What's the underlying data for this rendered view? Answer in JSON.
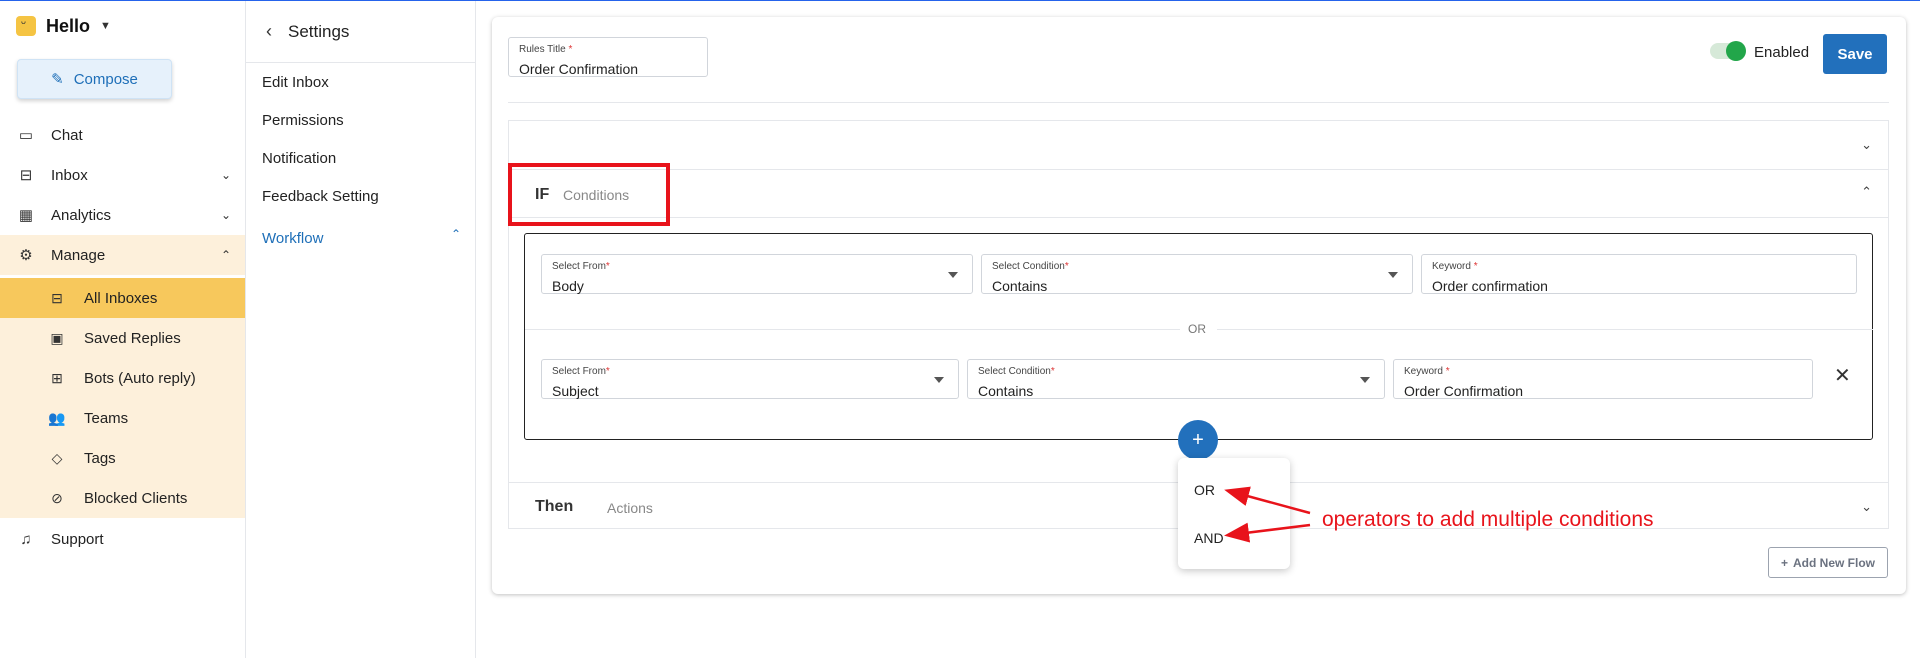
{
  "sidebar": {
    "brand": "Hello",
    "compose_label": "Compose",
    "nav": [
      {
        "label": "Chat",
        "icon": "chat-icon"
      },
      {
        "label": "Inbox",
        "icon": "inbox-icon"
      },
      {
        "label": "Analytics",
        "icon": "analytics-icon"
      },
      {
        "label": "Manage",
        "icon": "gear-icon"
      }
    ],
    "manage_items": [
      {
        "label": "All Inboxes",
        "icon": "inbox-icon",
        "active": true
      },
      {
        "label": "Saved Replies",
        "icon": "save-icon"
      },
      {
        "label": "Bots (Auto reply)",
        "icon": "bot-icon"
      },
      {
        "label": "Teams",
        "icon": "team-icon"
      },
      {
        "label": "Tags",
        "icon": "tag-icon"
      },
      {
        "label": "Blocked Clients",
        "icon": "block-icon"
      }
    ],
    "support": "Support"
  },
  "settings": {
    "title": "Settings",
    "items": [
      "Edit Inbox",
      "Permissions",
      "Notification",
      "Feedback Setting",
      "Workflow"
    ]
  },
  "rule": {
    "title_label": "Rules Title",
    "title_value": "Order Confirmation",
    "enabled_label": "Enabled",
    "enabled": true,
    "save_label": "Save"
  },
  "if_section": {
    "label": "IF",
    "sublabel": "Conditions",
    "conditions": [
      {
        "select_from_label": "Select From",
        "select_from": "Body",
        "condition_label": "Select Condition",
        "condition": "Contains",
        "keyword_label": "Keyword",
        "keyword": "Order confirmation"
      },
      {
        "select_from_label": "Select From",
        "select_from": "Subject",
        "condition_label": "Select Condition",
        "condition": "Contains",
        "keyword_label": "Keyword",
        "keyword": "Order Confirmation"
      }
    ],
    "separator": "OR",
    "operators": [
      "OR",
      "AND"
    ]
  },
  "then_section": {
    "label": "Then",
    "sublabel": "Actions"
  },
  "add_flow_label": "Add New Flow",
  "annotation": "operators to add multiple conditions",
  "colors": {
    "accent": "#2270bc",
    "highlight": "#f7c85c",
    "annotation": "#e8131b",
    "toggle_on": "#22a64a"
  }
}
